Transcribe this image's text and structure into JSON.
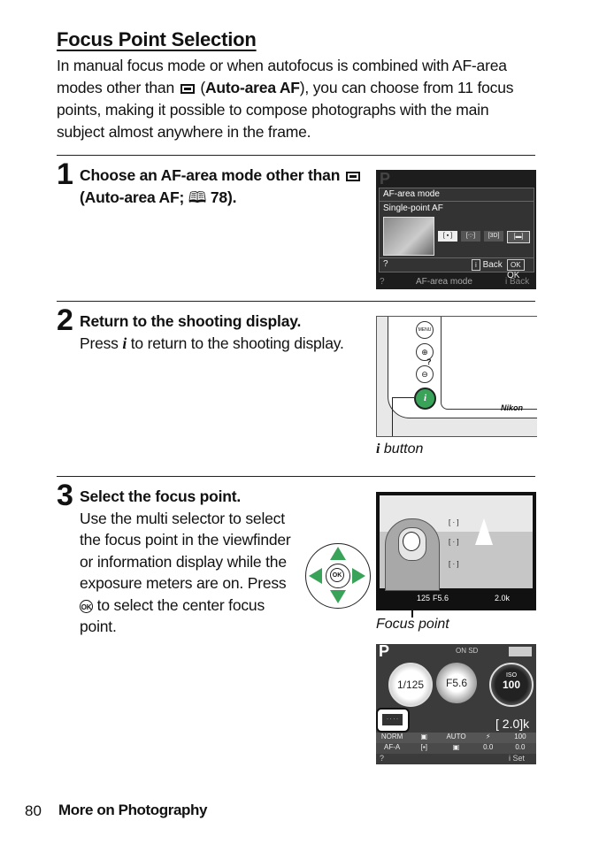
{
  "page": {
    "title": "Focus Point Selection",
    "intro": {
      "part1": "In manual focus mode or when autofocus is combined with AF-area modes other than ",
      "icon": "auto-area-af-icon",
      "part2": " (",
      "bold": "Auto-area AF",
      "part3": "), you can choose from 11 focus points, making it possible to compose photographs with the main subject almost anywhere in the frame."
    },
    "footer": {
      "page_number": "80",
      "section": "More on Photography"
    }
  },
  "steps": [
    {
      "number": "1",
      "heading_part1": "Choose an AF-area mode other than ",
      "heading_bold": "Auto-area AF; ",
      "page_ref_icon": "book-icon",
      "page_ref": "78",
      "heading_end": ").",
      "screen": {
        "mode": "P",
        "menu_title": "AF-area mode",
        "selected_option": "Single-point AF",
        "options": [
          "[ ▪ ]",
          "[⋅:⋅]",
          "[3D]",
          "[▬]"
        ],
        "help": "?",
        "back_label": "Back",
        "ok_label": "OK",
        "bottom_label": "AF-area mode",
        "bottom_back": "Back"
      }
    },
    {
      "number": "2",
      "heading": "Return to the shooting display.",
      "body_part1": "Press ",
      "body_glyph": "i",
      "body_part2": " to return to the shooting display.",
      "illustration": {
        "buttons": [
          "MENU",
          "⊕",
          "⊖",
          "i"
        ],
        "brand": "Nikon",
        "caption_glyph": "i",
        "caption": " button"
      }
    },
    {
      "number": "3",
      "heading": "Select the focus point.",
      "body_part1": "Use the multi selector to select the focus point in the viewfinder or information display while the exposure meters are on.  Press ",
      "body_glyph": "OK",
      "body_part2": " to select the center focus point.",
      "multi_selector": {
        "center": "OK"
      },
      "viewfinder": {
        "shutter": "125",
        "aperture": "F5.6",
        "right": "2.0k",
        "caption": "Focus point"
      },
      "info_display": {
        "mode": "P",
        "status": "ON  SD",
        "shutter": "1/125",
        "aperture": "F5.6",
        "iso_label": "ISO",
        "iso": "100",
        "remaining": "[  2.0]k",
        "row1": [
          "NORM",
          "▣",
          "AUTO",
          "⚡",
          "100"
        ],
        "row2": [
          "AF-A",
          "[▪]",
          "▣",
          "0.0",
          "0.0"
        ],
        "help": "?",
        "set_label": "Set"
      }
    }
  ]
}
